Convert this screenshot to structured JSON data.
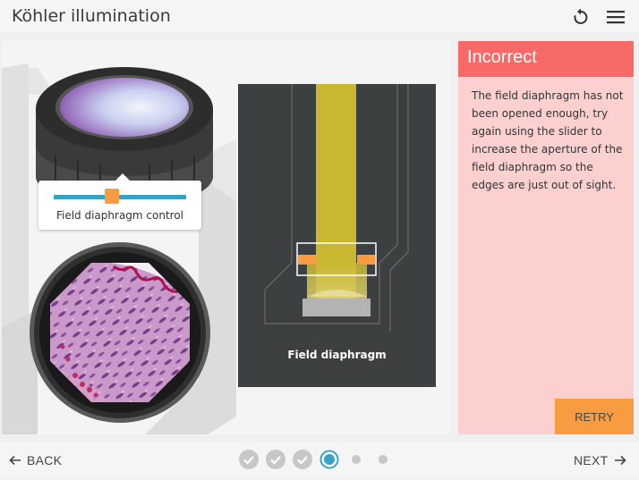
{
  "header": {
    "title": "Köhler illumination",
    "reset_icon": "reset-icon",
    "menu_icon": "hamburger-menu-icon"
  },
  "slider": {
    "label": "Field diaphragm control",
    "value_fraction": 0.44
  },
  "schematic": {
    "label": "Field diaphragm"
  },
  "feedback": {
    "title": "Incorrect",
    "message": "The field diaphragm has not been opened enough, try again using the slider to increase the aperture of the field diaphragm so the edges are just out of sight.",
    "retry_label": "RETRY"
  },
  "footer": {
    "back_label": "BACK",
    "next_label": "NEXT",
    "steps": [
      "complete",
      "complete",
      "complete",
      "current",
      "pending",
      "pending"
    ]
  },
  "colors": {
    "accent_orange": "#f99b40",
    "feedback_red": "#f76a67",
    "feedback_bg": "#fdd0d0",
    "slider_blue": "#3aa2c8",
    "beam_yellow": "#c9b72f"
  }
}
